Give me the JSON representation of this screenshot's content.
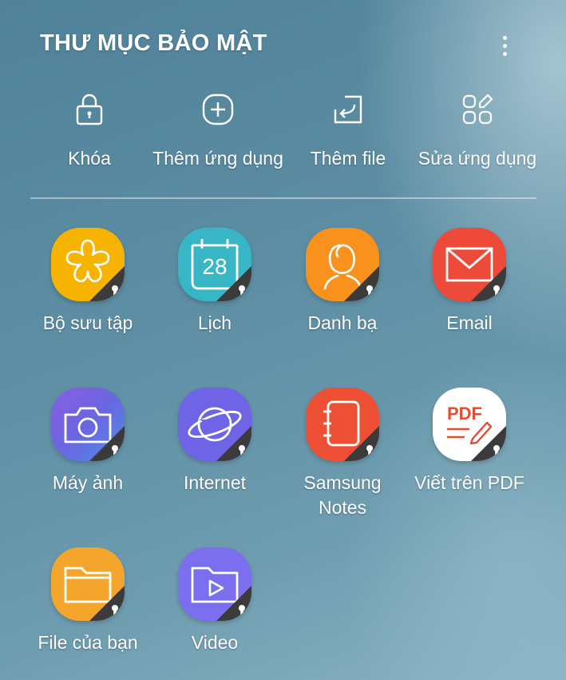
{
  "header": {
    "title": "THƯ MỤC BẢO MẬT",
    "menu_icon": "more-vert-icon"
  },
  "actions": [
    {
      "label": "Khóa",
      "icon": "lock-icon"
    },
    {
      "label": "Thêm ứng dụng",
      "icon": "add-circle-icon"
    },
    {
      "label": "Thêm file",
      "icon": "add-file-icon"
    },
    {
      "label": "Sửa ứng dụng",
      "icon": "edit-apps-icon"
    }
  ],
  "apps": [
    {
      "label": "Bộ sưu tập",
      "icon": "gallery-flower-icon",
      "color": "#f6b400"
    },
    {
      "label": "Lịch",
      "icon": "calendar-icon",
      "color": "#39b6c6",
      "calendar_day": "28"
    },
    {
      "label": "Danh bạ",
      "icon": "contacts-icon",
      "color": "#f9921c"
    },
    {
      "label": "Email",
      "icon": "email-icon",
      "color": "#ee4a3a"
    },
    {
      "label": "Máy ảnh",
      "icon": "camera-icon",
      "color": "#6a66e0"
    },
    {
      "label": "Internet",
      "icon": "internet-planet-icon",
      "color": "#6f63e6"
    },
    {
      "label": "Samsung Notes",
      "label_line1": "Samsung",
      "label_line2": "Notes",
      "icon": "notes-icon",
      "color": "#ee5035"
    },
    {
      "label": "Viết trên PDF",
      "icon": "pdf-write-icon",
      "color": "#ffffff",
      "pdf_text": "PDF"
    },
    {
      "label": "File của bạn",
      "icon": "folder-icon",
      "color": "#f4a62c"
    },
    {
      "label": "Video",
      "icon": "video-icon",
      "color": "#7b6ff0"
    }
  ],
  "lock_badge_icon": "lock-badge-icon"
}
